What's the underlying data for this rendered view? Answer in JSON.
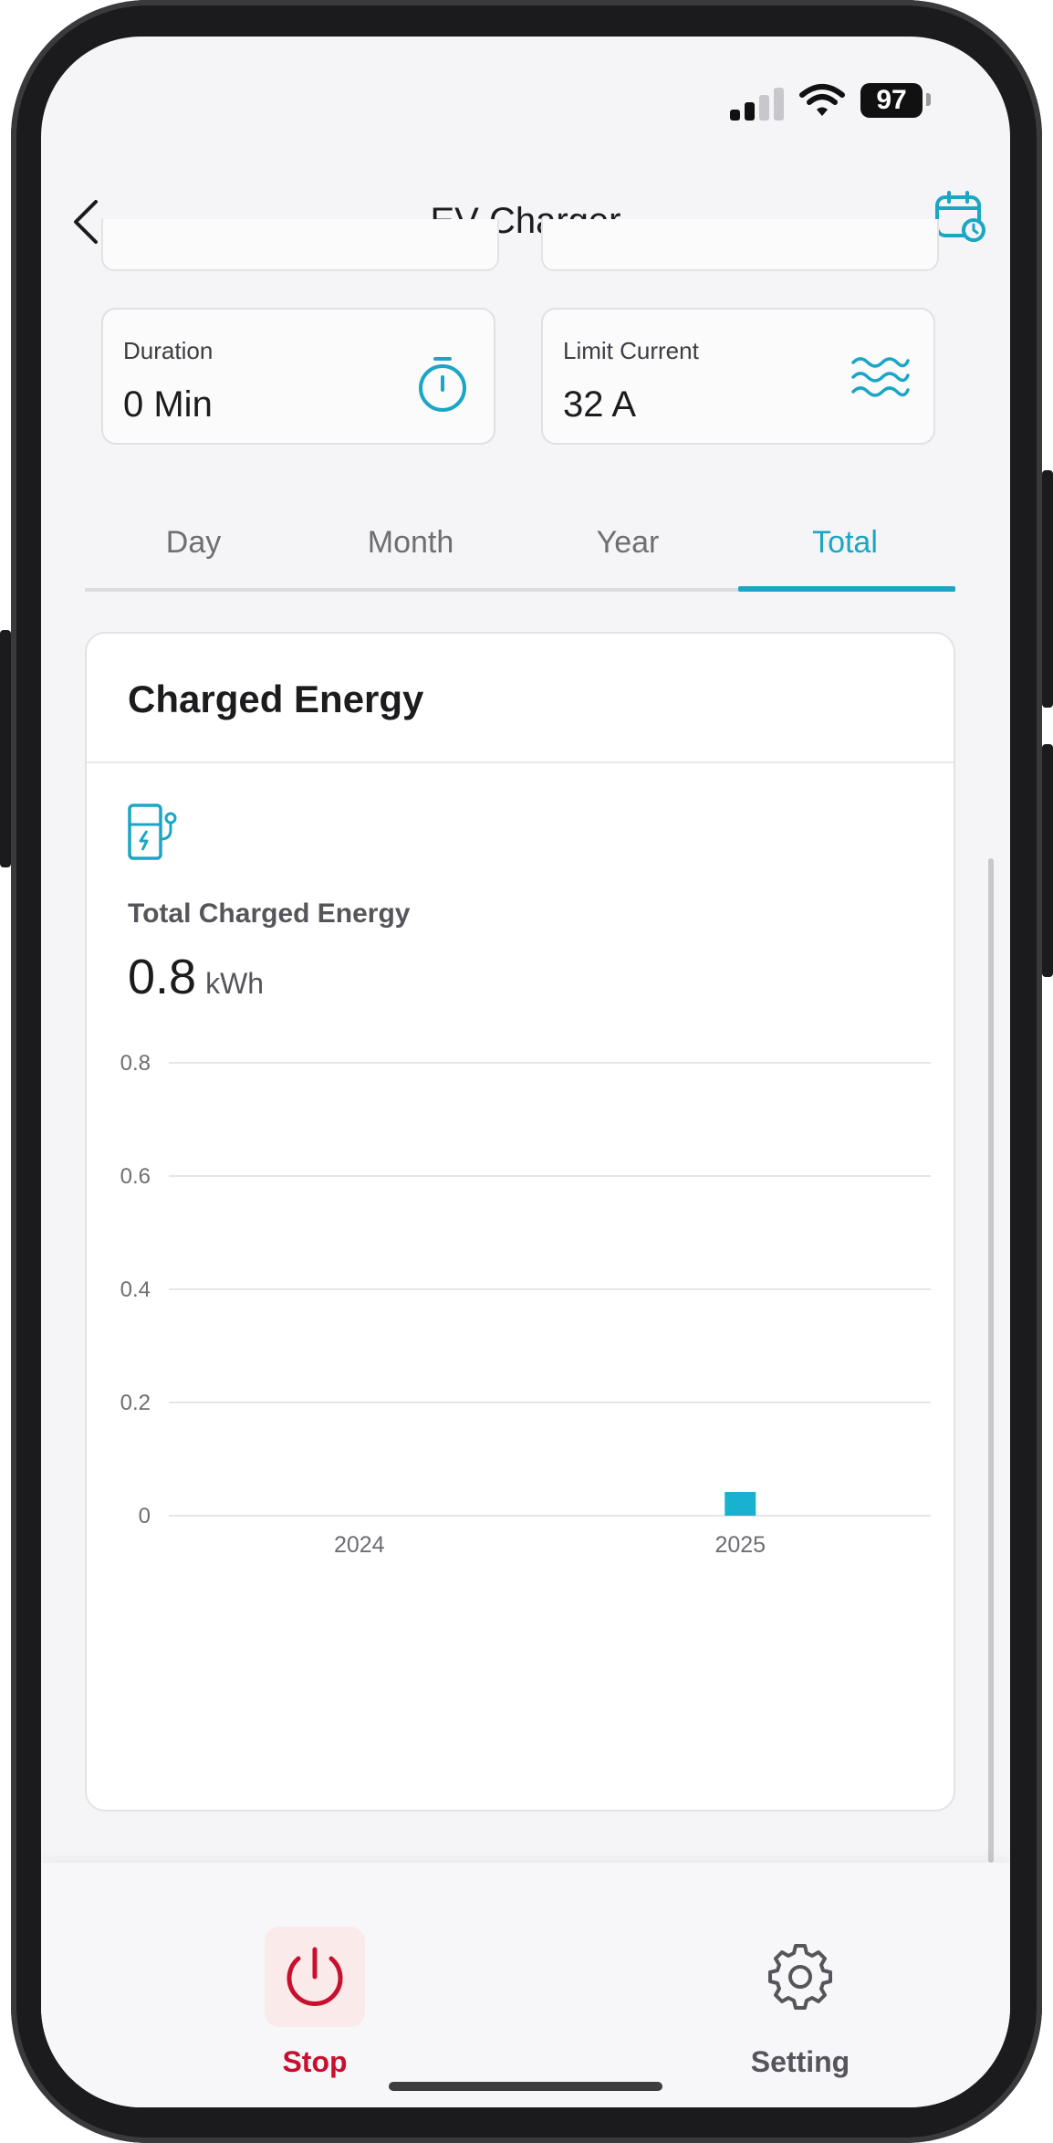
{
  "status_bar": {
    "battery": "97"
  },
  "header": {
    "title": "EV Charger"
  },
  "stats": {
    "duration": {
      "label": "Duration",
      "value": "0 Min"
    },
    "limit_current": {
      "label": "Limit Current",
      "value": "32 A"
    }
  },
  "tabs": [
    {
      "label": "Day"
    },
    {
      "label": "Month"
    },
    {
      "label": "Year"
    },
    {
      "label": "Total"
    }
  ],
  "active_tab": "Total",
  "energy": {
    "title": "Charged Energy",
    "total_label": "Total Charged Energy",
    "total_value": "0.8",
    "total_unit": "kWh"
  },
  "chart_data": {
    "type": "bar",
    "categories": [
      "2024",
      "2025"
    ],
    "values": [
      0,
      0.02
    ],
    "yticks": [
      0,
      0.2,
      0.4,
      0.6,
      0.8
    ],
    "ylim": [
      0,
      0.8
    ],
    "grid": true,
    "color": "#1ab0d0"
  },
  "bottom_nav": {
    "stop": {
      "label": "Stop",
      "color": "#c8102e"
    },
    "setting": {
      "label": "Setting",
      "color": "#55555b"
    }
  },
  "colors": {
    "accent": "#1aa6c4",
    "stop": "#c8102e"
  }
}
